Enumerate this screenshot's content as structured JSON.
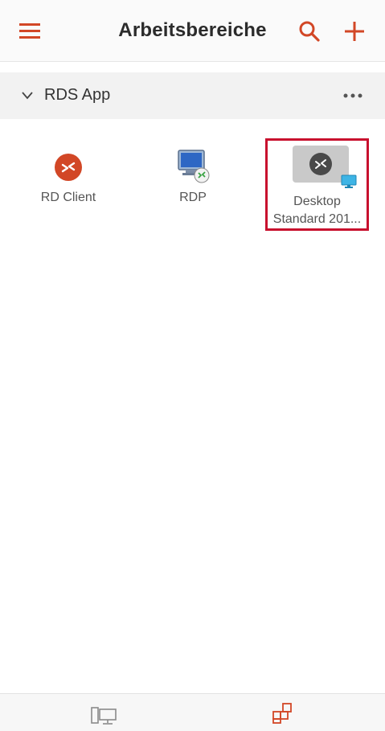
{
  "header": {
    "title": "Arbeitsbereiche",
    "menu_icon": "hamburger-menu-icon",
    "search_icon": "search-icon",
    "add_icon": "plus-icon"
  },
  "group": {
    "name": "RDS App",
    "expanded": true,
    "more_icon": "ellipsis-icon"
  },
  "apps": [
    {
      "label": "RD Client",
      "icon": "remote-desktop-logo-icon"
    },
    {
      "label": "RDP",
      "icon": "rdp-monitor-icon"
    },
    {
      "label_line1": "Desktop",
      "label_line2": "Standard 201...",
      "icon": "desktop-connection-icon",
      "selected": true
    }
  ],
  "bottom_nav": {
    "items": [
      {
        "icon": "pc-icon",
        "active": false
      },
      {
        "icon": "apps-grid-icon",
        "active": true
      }
    ]
  },
  "colors": {
    "accent": "#d24726",
    "selection_border": "#c8102e",
    "header_bg": "#fafafa",
    "group_bg": "#f2f2f2"
  }
}
